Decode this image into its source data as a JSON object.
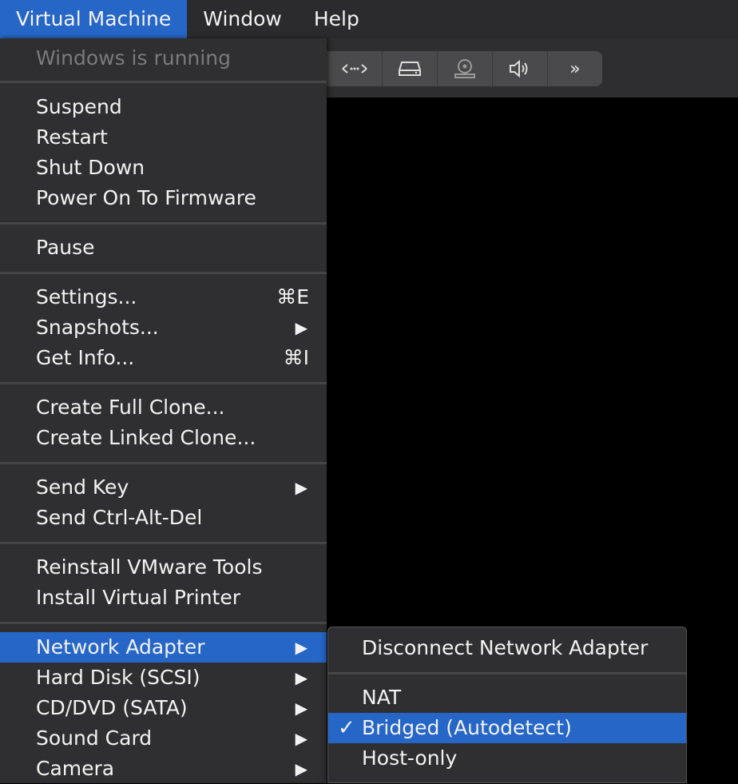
{
  "menubar": {
    "items": [
      "Virtual Machine",
      "Window",
      "Help"
    ]
  },
  "toolbar": {
    "icons": [
      "network-arrows-icon",
      "hard-disk-icon",
      "camera-icon",
      "sound-icon",
      "more-icon"
    ],
    "more_glyph": "»"
  },
  "menu": {
    "status": "Windows is running",
    "suspend": "Suspend",
    "restart": "Restart",
    "shut_down": "Shut Down",
    "power_on_firmware": "Power On To Firmware",
    "pause": "Pause",
    "settings": "Settings...",
    "settings_shortcut": "⌘E",
    "snapshots": "Snapshots...",
    "get_info": "Get Info...",
    "get_info_shortcut": "⌘I",
    "create_full_clone": "Create Full Clone...",
    "create_linked_clone": "Create Linked Clone...",
    "send_key": "Send Key",
    "send_ctrl_alt_del": "Send Ctrl-Alt-Del",
    "reinstall_tools": "Reinstall VMware Tools",
    "install_printer": "Install Virtual Printer",
    "network_adapter": "Network Adapter",
    "hard_disk": "Hard Disk (SCSI)",
    "cd_dvd": "CD/DVD (SATA)",
    "sound_card": "Sound Card",
    "camera": "Camera",
    "arrow": "▶"
  },
  "submenu": {
    "disconnect": "Disconnect Network Adapter",
    "nat": "NAT",
    "bridged": "Bridged (Autodetect)",
    "host_only": "Host-only",
    "check": "✓",
    "selected": "Bridged (Autodetect)"
  },
  "colors": {
    "highlight": "#2566c7",
    "menu_bg": "#2f2f31"
  }
}
